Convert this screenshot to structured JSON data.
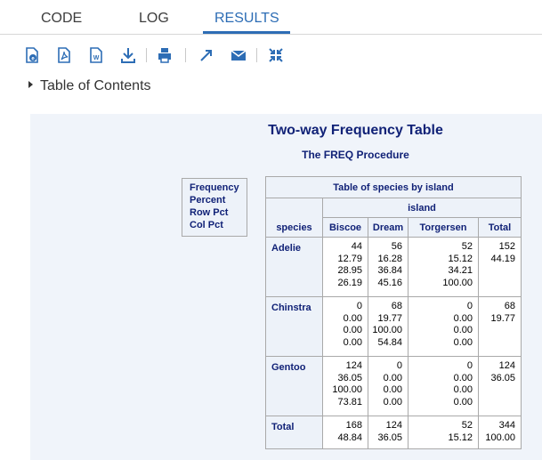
{
  "tabs": [
    {
      "label": "CODE"
    },
    {
      "label": "LOG"
    },
    {
      "label": "RESULTS"
    }
  ],
  "toolbar": {
    "buttons": [
      "download-html-icon",
      "download-pdf-icon",
      "download-rtf-icon",
      "download-icon",
      "print-icon",
      "open-new-window-icon",
      "email-icon",
      "collapse-icon"
    ]
  },
  "toc": {
    "label": "Table of Contents"
  },
  "results": {
    "title": "Two-way Frequency Table",
    "subtitle": "The FREQ Procedure",
    "legend": [
      "Frequency",
      "Percent",
      "Row Pct",
      "Col Pct"
    ],
    "table": {
      "caption": "Table of species by island",
      "col_var": "island",
      "row_var": "species",
      "columns": [
        "Biscoe",
        "Dream",
        "Torgersen",
        "Total"
      ],
      "rows": [
        {
          "label": "Adelie",
          "cells": [
            [
              "44",
              "12.79",
              "28.95",
              "26.19"
            ],
            [
              "56",
              "16.28",
              "36.84",
              "45.16"
            ],
            [
              "52",
              "15.12",
              "34.21",
              "100.00"
            ],
            [
              "152",
              "44.19"
            ]
          ]
        },
        {
          "label": "Chinstra",
          "cells": [
            [
              "0",
              "0.00",
              "0.00",
              "0.00"
            ],
            [
              "68",
              "19.77",
              "100.00",
              "54.84"
            ],
            [
              "0",
              "0.00",
              "0.00",
              "0.00"
            ],
            [
              "68",
              "19.77"
            ]
          ]
        },
        {
          "label": "Gentoo",
          "cells": [
            [
              "124",
              "36.05",
              "100.00",
              "73.81"
            ],
            [
              "0",
              "0.00",
              "0.00",
              "0.00"
            ],
            [
              "0",
              "0.00",
              "0.00",
              "0.00"
            ],
            [
              "124",
              "36.05"
            ]
          ]
        },
        {
          "label": "Total",
          "cells": [
            [
              "168",
              "48.84"
            ],
            [
              "124",
              "36.05"
            ],
            [
              "52",
              "15.12"
            ],
            [
              "344",
              "100.00"
            ]
          ]
        }
      ]
    }
  },
  "colors": {
    "accent": "#2d6db5",
    "header_text": "#112277",
    "panel_bg": "#f0f4fa"
  }
}
